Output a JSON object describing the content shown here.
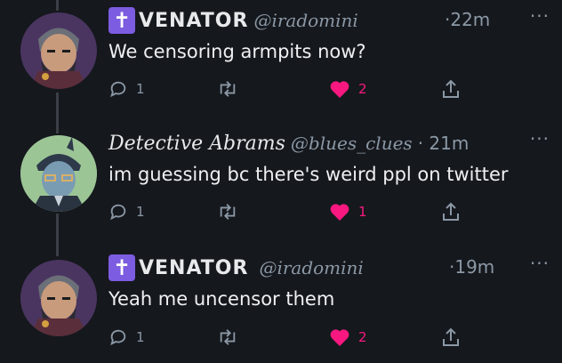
{
  "colors": {
    "background": "#15181d",
    "text": "#e7e9ea",
    "secondary": "#8b98a5",
    "like": "#f91880",
    "badge": "#7c5ce0"
  },
  "tweets": [
    {
      "badge": "✝",
      "name": "VENATOR",
      "handle": "@iradomini",
      "time": "·22m",
      "more": "···",
      "text": "We censoring armpits now?",
      "reply_count": "1",
      "like_count": "2",
      "avatar_icon": "warrior-avatar-icon"
    },
    {
      "badge": "",
      "name": "Detective Abrams",
      "handle": "@blues_clues",
      "time": "· 21m",
      "more": "···",
      "text": "im guessing bc there's weird ppl on twitter",
      "reply_count": "1",
      "like_count": "1",
      "avatar_icon": "detective-avatar-icon"
    },
    {
      "badge": "✝",
      "name": "VENATOR",
      "handle": "@iradomini",
      "time": "·19m",
      "more": "···",
      "text": "Yeah me uncensor them",
      "reply_count": "1",
      "like_count": "2",
      "avatar_icon": "warrior-avatar-icon"
    }
  ]
}
